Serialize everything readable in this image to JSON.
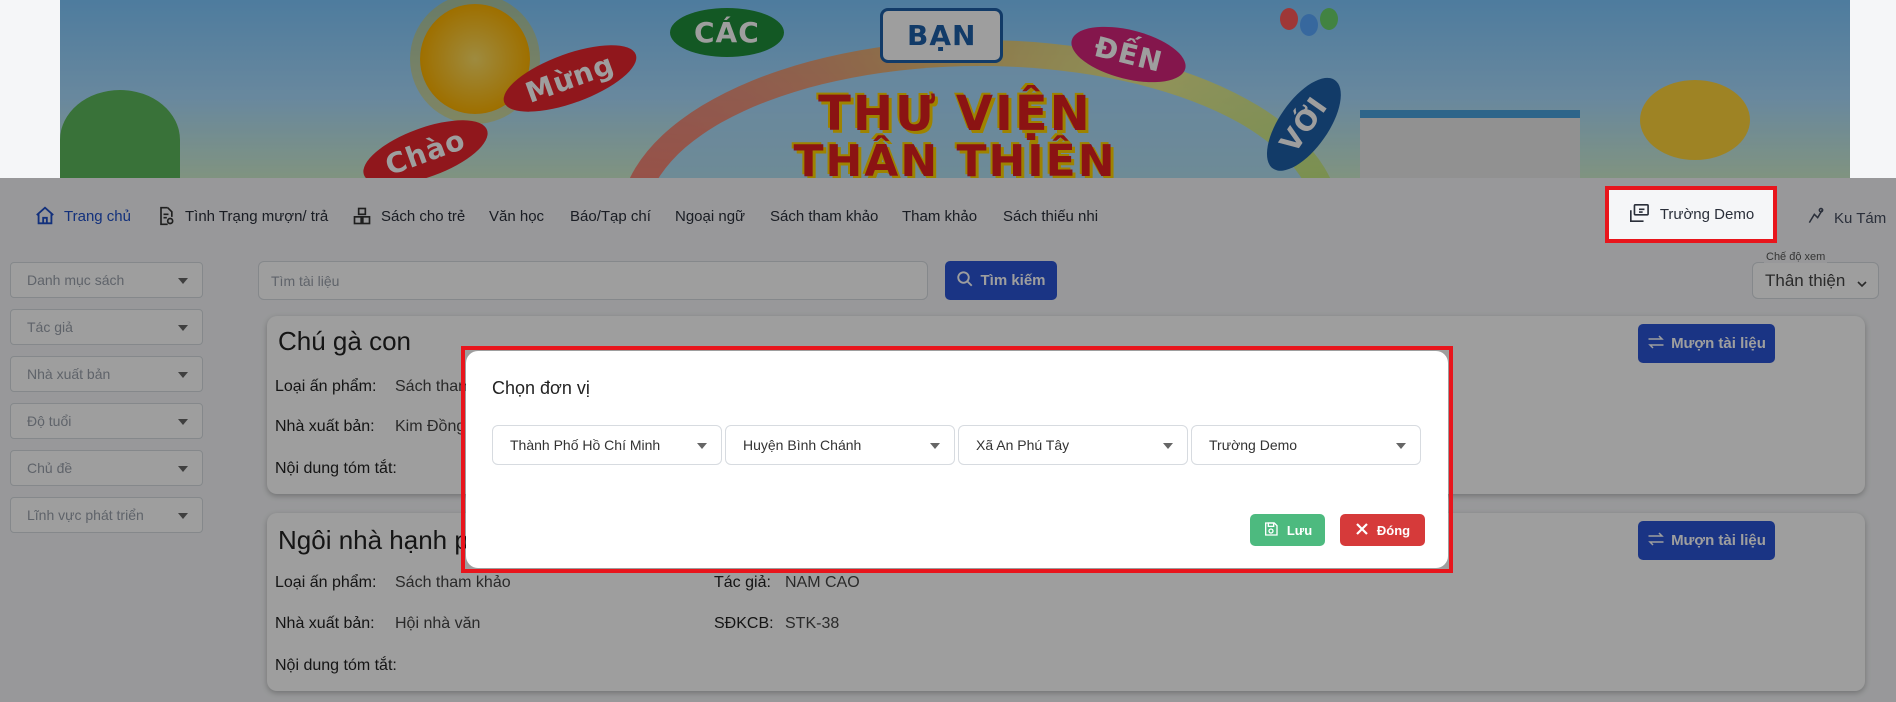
{
  "banner": {
    "line1": "THƯ VIỆN",
    "line2": "THÂN THIỆN",
    "bubbles": [
      "Mừng",
      "CÁC",
      "BẠN",
      "ĐẾN",
      "VỚI",
      "Chào"
    ]
  },
  "nav": {
    "items": [
      {
        "label": "Trang chủ",
        "icon": "home-icon"
      },
      {
        "label": "Tình Trạng mượn/ trả",
        "icon": "document-check-icon"
      },
      {
        "label": "Sách cho trẻ",
        "icon": "boxes-icon"
      },
      {
        "label": "Văn học"
      },
      {
        "label": "Báo/Tạp chí"
      },
      {
        "label": "Ngoại ngữ"
      },
      {
        "label": "Sách tham khảo"
      },
      {
        "label": "Tham khảo"
      },
      {
        "label": "Sách thiếu nhi"
      }
    ],
    "school": "Trường Demo",
    "user": "Ku Tám"
  },
  "filters": [
    "Danh mục sách",
    "Tác giả",
    "Nhà xuất bản",
    "Độ tuổi",
    "Chủ đề",
    "Lĩnh vực phát triển"
  ],
  "search": {
    "placeholder": "Tìm tài liệu",
    "button": "Tìm kiếm"
  },
  "view_mode": {
    "label": "Chế độ xem",
    "value": "Thân thiện"
  },
  "cards": [
    {
      "title": "Chú gà con",
      "type_label": "Loại ấn phẩm:",
      "type_value": "Sách tham",
      "publisher_label": "Nhà xuất bản:",
      "publisher_value": "Kim Đồng",
      "summary_label": "Nội dung tóm tắt:",
      "borrow": "Mượn tài liệu"
    },
    {
      "title": "Ngôi nhà hạnh ph",
      "type_label": "Loại ấn phẩm:",
      "type_value": "Sách tham khảo",
      "publisher_label": "Nhà xuất bản:",
      "publisher_value": "Hội nhà văn",
      "author_label": "Tác giả:",
      "author_value": "NAM CAO",
      "code_label": "SĐKCB:",
      "code_value": "STK-38",
      "summary_label": "Nội dung tóm tắt:",
      "borrow": "Mượn tài liệu"
    }
  ],
  "modal": {
    "title": "Chọn đơn vị",
    "selects": [
      "Thành Phố Hồ Chí Minh",
      "Huyện Bình Chánh",
      "Xã An Phú Tây",
      "Trường Demo"
    ],
    "save": "Lưu",
    "close": "Đóng"
  },
  "colors": {
    "primary": "#2a55d6",
    "save": "#4dba7f",
    "close": "#d63a3a",
    "highlight": "#e8151c"
  }
}
